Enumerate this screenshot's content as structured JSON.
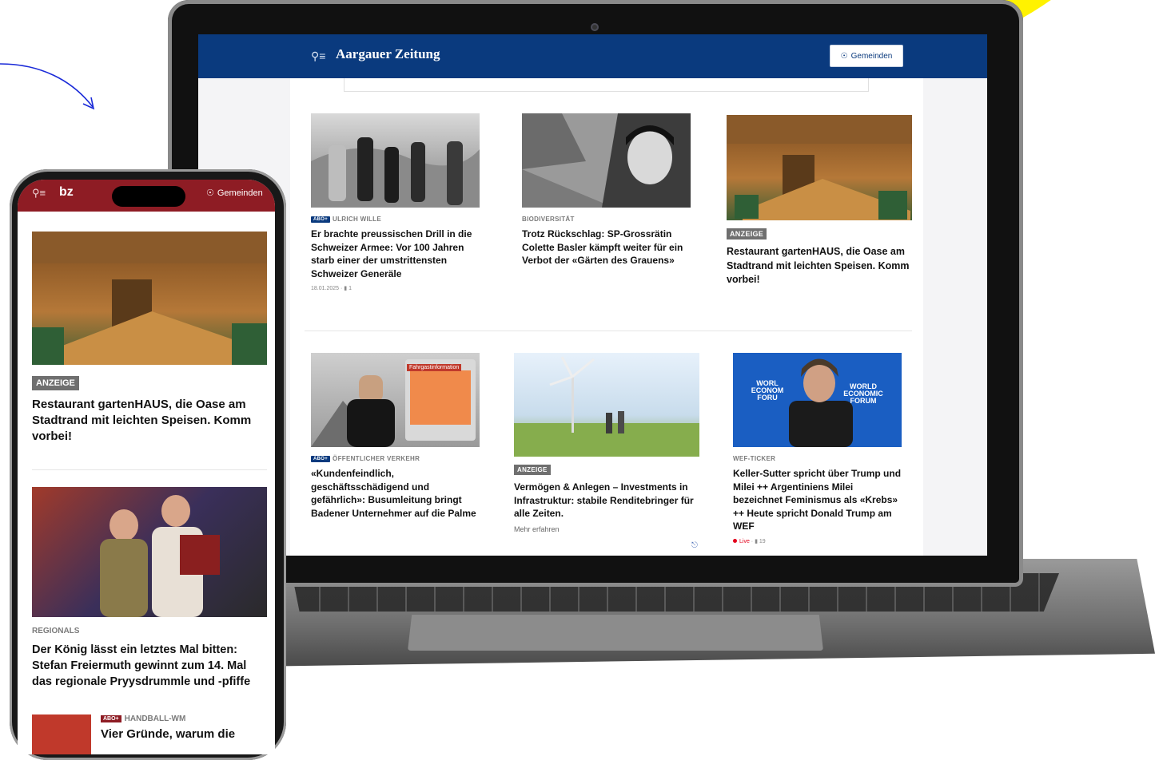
{
  "laptop": {
    "brand": "Aargauer Zeitung",
    "header_button": "Gemeinden",
    "articles": [
      {
        "kicker": "ULRICH WILLE",
        "abo": "abo+",
        "title": "Er brachte preussischen Drill in die Schweizer Armee: Vor 100 Jahren starb einer der umstrittensten Schweizer Generäle",
        "date": "18.01.2025",
        "comments": "1"
      },
      {
        "kicker": "BIODIVERSITÄT",
        "title": "Trotz Rückschlag: SP-Grossrätin Colette Basler kämpft weiter für ein Verbot der «Gärten des Grauens»"
      },
      {
        "badge": "ANZEIGE",
        "title": "Restaurant gartenHAUS, die Oase am Stadtrand mit leichten Speisen. Komm vorbei!"
      },
      {
        "kicker": "ÖFFENTLICHER VERKEHR",
        "abo": "abo+",
        "title": "«Kundenfeindlich, geschäftsschädigend und gefährlich»: Busumleitung bringt Badener Unternehmer auf die Palme",
        "sign": "Fahrgastinformation"
      },
      {
        "badge": "ANZEIGE",
        "title": "Vermögen & Anlegen – Investments in Infrastruktur: stabile Renditebringer für alle Zeiten.",
        "more": "Mehr erfahren"
      },
      {
        "kicker": "WEF-TICKER",
        "title": "Keller-Sutter spricht über Trump und Milei ++ Argentiniens Milei bezeichnet Feminismus als «Krebs» ++ Heute spricht Donald Trump am WEF",
        "live": "Live",
        "comments": "19",
        "wef_left": "WORL ECONOM FORU",
        "wef_right": "WORLD ECONOMIC FORUM"
      }
    ]
  },
  "phone": {
    "brand": "bz",
    "header_button": "Gemeinden",
    "articles": [
      {
        "badge": "ANZEIGE",
        "title": "Restaurant gartenHAUS, die Oase am Stadtrand mit leichten Speisen. Komm vorbei!"
      },
      {
        "kicker": "REGIONALS",
        "title": "Der König lässt ein letztes Mal bitten: Stefan Freiermuth gewinnt zum 14. Mal das regionale Pryysdrummle und -pfiffe"
      },
      {
        "kicker": "HANDBALL-WM",
        "abo": "abo+",
        "title": "Vier Gründe, warum die"
      }
    ]
  },
  "colors": {
    "laptop_header": "#0a3a7e",
    "phone_header": "#8e1c24",
    "background_accent": "#fff200"
  }
}
